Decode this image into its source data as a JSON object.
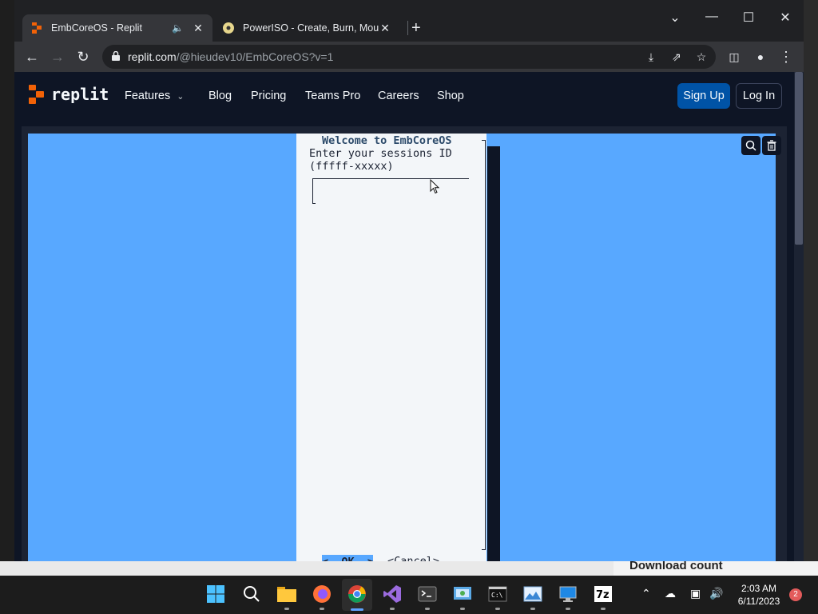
{
  "browser": {
    "tabs": [
      {
        "title": "EmbCoreOS - Replit",
        "active": true,
        "audio": true
      },
      {
        "title": "PowerISO - Create, Burn, Mount,",
        "active": false
      }
    ],
    "new_tab": "+",
    "window_controls": {
      "expand": "⌄",
      "minimize": "—",
      "maximize": "☐",
      "close": "✕"
    },
    "url_host": "replit.com",
    "url_path": "/@hieudev10/EmbCoreOS?v=1"
  },
  "site": {
    "logo_text": "replit",
    "nav": [
      "Features",
      "Blog",
      "Pricing",
      "Teams Pro",
      "Careers",
      "Shop"
    ],
    "signup": "Sign Up",
    "login": "Log In"
  },
  "console": {
    "title": "Welcome to EmbCoreOS",
    "prompt_line1": "Enter your sessions ID",
    "prompt_line2": "(fffff-xxxxx)",
    "input_value": "",
    "ok_label": "<  OK  >",
    "cancel_label": "<Cancel>"
  },
  "background": {
    "download_count": "Download count"
  },
  "taskbar": {
    "time": "2:03 AM",
    "date": "6/11/2023",
    "notification_count": "2",
    "apps": [
      "start-icon",
      "search-icon",
      "file-explorer-icon",
      "firefox-icon",
      "chrome-icon",
      "visual-studio-icon",
      "terminal-icon",
      "control-panel-icon",
      "cmd-icon",
      "photos-icon",
      "remote-desktop-icon",
      "7zip-icon"
    ]
  },
  "colors": {
    "console_bg": "#58a8ff",
    "replit_bg": "#0e1525",
    "signup_bg": "#0053a6",
    "replit_orange": "#f26207"
  }
}
